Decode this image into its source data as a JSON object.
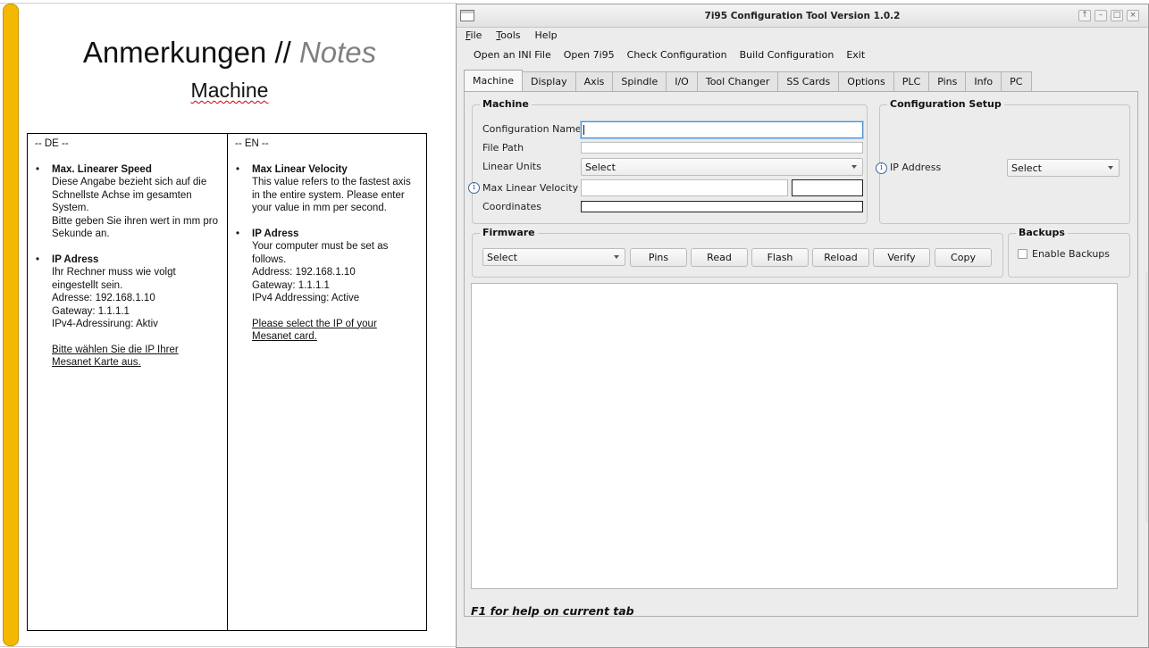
{
  "doc": {
    "title_main": "Anmerkungen //",
    "title_italic": "Notes",
    "subtitle": "Machine",
    "de": {
      "header": "-- DE --",
      "items": [
        {
          "heading": "Max. Linearer Speed",
          "lines": [
            "Diese Angabe bezieht sich auf die Schnellste Achse im gesamten System.",
            "Bitte geben Sie ihren wert in mm pro Sekunde an."
          ]
        },
        {
          "heading": "IP Adress",
          "lines": [
            "Ihr Rechner muss wie volgt eingestellt sein.",
            "Adresse: 192.168.1.10",
            "Gateway: 1.1.1.1",
            "IPv4-Adressirung: Aktiv"
          ],
          "note": "Bitte wählen Sie die IP Ihrer Mesanet Karte aus."
        }
      ]
    },
    "en": {
      "header": "-- EN --",
      "items": [
        {
          "heading": "Max Linear Velocity",
          "lines": [
            "This value refers to the fastest axis in the entire system. Please enter your value in mm per second."
          ]
        },
        {
          "heading": "IP Adress",
          "lines": [
            "Your computer must be set as follows.",
            "Address: 192.168.1.10",
            "Gateway: 1.1.1.1",
            "IPv4 Addressing: Active"
          ],
          "note": "Please select the IP of your Mesanet card."
        }
      ]
    }
  },
  "window": {
    "title": "7i95 Configuration Tool Version 1.0.2",
    "controls": [
      "↑",
      "–",
      "□",
      "×"
    ]
  },
  "menu": {
    "file": {
      "acc": "F",
      "rest": "ile"
    },
    "tools": {
      "acc": "T",
      "rest": "ools"
    },
    "help": {
      "acc": "",
      "rest": "Help"
    }
  },
  "toolbar": {
    "open_ini": "Open an INI File",
    "open_7i95": "Open 7i95",
    "check": "Check Configuration",
    "build": "Build Configuration",
    "exit": "Exit"
  },
  "tabs": [
    "Machine",
    "Display",
    "Axis",
    "Spindle",
    "I/O",
    "Tool Changer",
    "SS Cards",
    "Options",
    "PLC",
    "Pins",
    "Info",
    "PC"
  ],
  "machine": {
    "group_title": "Machine",
    "config_name_label": "Configuration Name",
    "config_name_value": "",
    "file_path_label": "File Path",
    "file_path_value": "",
    "linear_units_label": "Linear Units",
    "linear_units_value": "Select",
    "max_linear_velocity_label": "Max Linear Velocity",
    "max_linear_velocity_value": "",
    "max_linear_velocity_converted": "",
    "coordinates_label": "Coordinates",
    "coordinates_value": ""
  },
  "config_setup": {
    "group_title": "Configuration Setup",
    "ip_label": "IP Address",
    "ip_value": "Select"
  },
  "firmware": {
    "group_title": "Firmware",
    "select_value": "Select",
    "buttons": [
      "Pins",
      "Read",
      "Flash",
      "Reload",
      "Verify",
      "Copy"
    ]
  },
  "backups": {
    "group_title": "Backups",
    "enable_label": "Enable Backups",
    "enabled": false
  },
  "output_text": "",
  "help_text": "F1 for help on current tab"
}
